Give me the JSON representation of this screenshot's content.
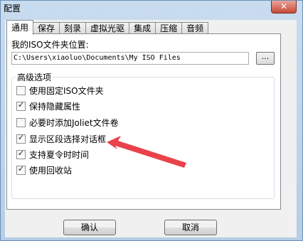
{
  "window": {
    "title": "配置",
    "close_glyph": "✕"
  },
  "tabs": [
    {
      "label": "通用",
      "active": true
    },
    {
      "label": "保存",
      "active": false
    },
    {
      "label": "刻录",
      "active": false
    },
    {
      "label": "虚拟光驱",
      "active": false
    },
    {
      "label": "集成",
      "active": false
    },
    {
      "label": "压缩",
      "active": false
    },
    {
      "label": "音频",
      "active": false
    }
  ],
  "iso_folder": {
    "label": "我的ISO文件夹位置:",
    "value": "C:\\Users\\xiaoluo\\Documents\\My ISO Files",
    "browse_label": "..."
  },
  "advanced": {
    "title": "高级选项",
    "options": [
      {
        "label": "使用固定ISO文件夹",
        "checked": false
      },
      {
        "label": "保持隐藏属性",
        "checked": true
      },
      {
        "label": "必要时添加Joliet文件卷",
        "checked": false
      },
      {
        "label": "显示区段选择对话框",
        "checked": true
      },
      {
        "label": "支持夏令时时间",
        "checked": true
      },
      {
        "label": "使用回收站",
        "checked": true
      }
    ]
  },
  "buttons": {
    "ok": "确认",
    "cancel": "取消"
  },
  "colors": {
    "annotation_arrow": "#e8424a"
  }
}
